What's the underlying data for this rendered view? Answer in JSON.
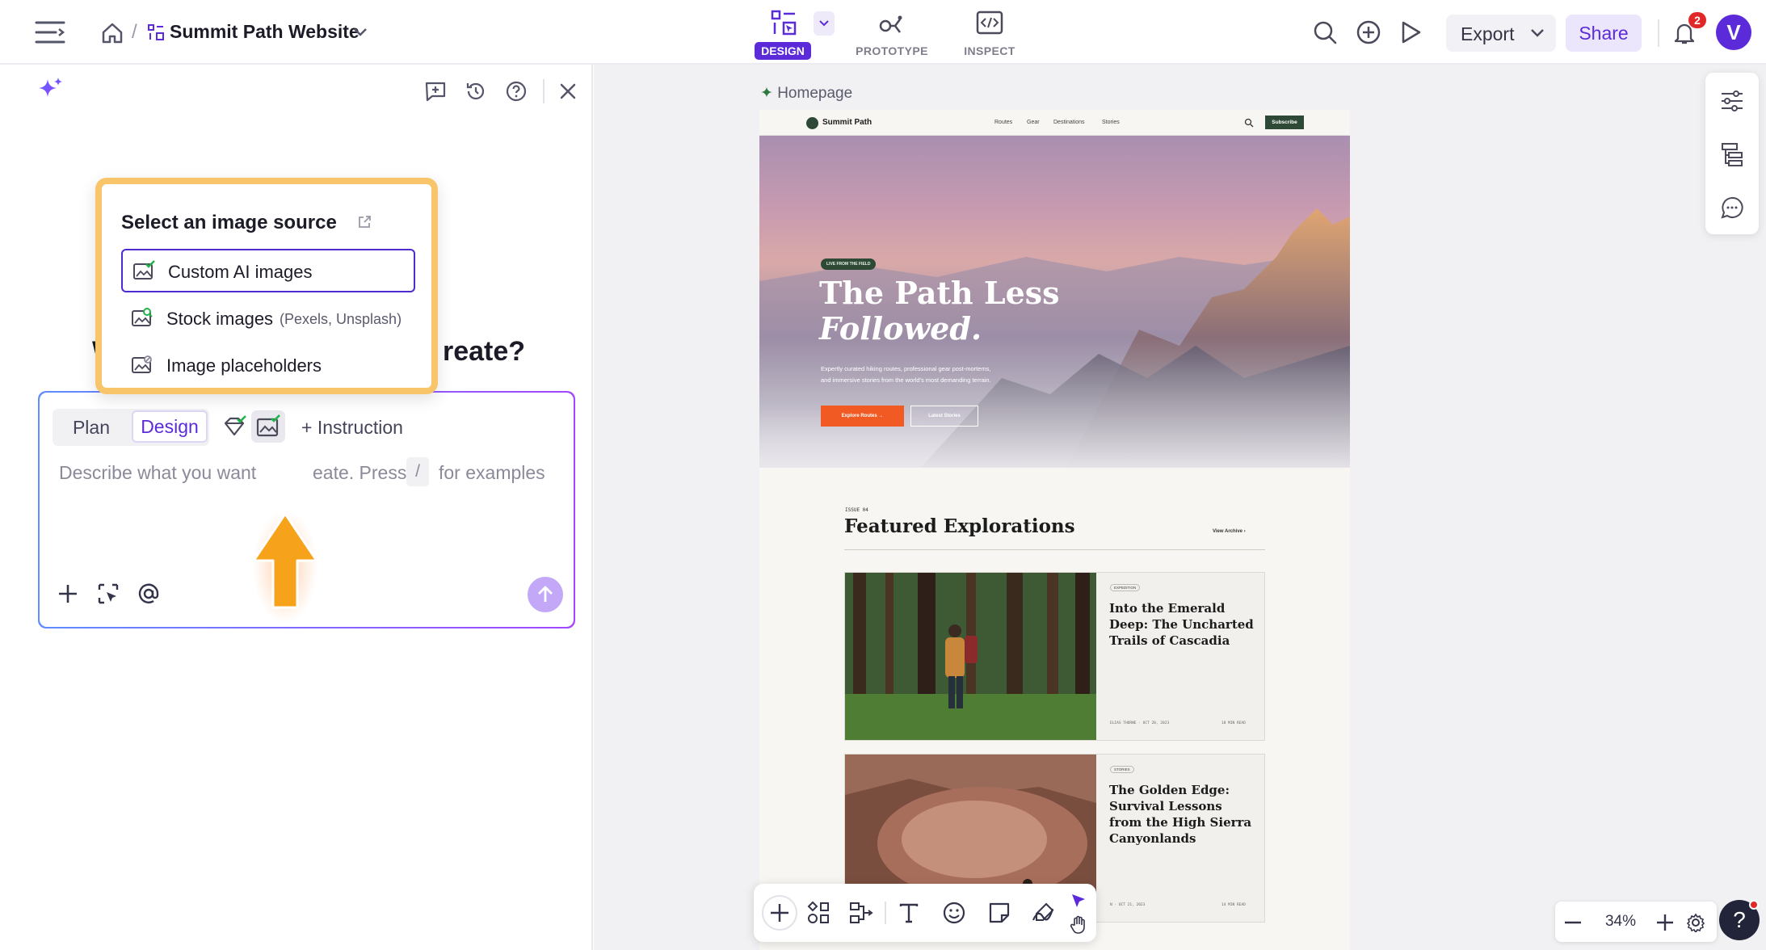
{
  "topbar": {
    "breadcrumb_separator": "/",
    "project_name": "Summit Path Website",
    "modes": [
      {
        "label": "DESIGN",
        "active": true
      },
      {
        "label": "PROTOTYPE",
        "active": false
      },
      {
        "label": "INSPECT",
        "active": false
      }
    ],
    "export_label": "Export",
    "share_label": "Share",
    "notification_count": "2",
    "avatar_initial": "V"
  },
  "panel": {
    "heading_left": "W",
    "heading_right": "reate?",
    "popup": {
      "title": "Select an image source",
      "options": [
        {
          "label": "Custom AI images",
          "note": "",
          "selected": true
        },
        {
          "label": "Stock images",
          "note": "(Pexels, Unsplash)",
          "selected": false
        },
        {
          "label": "Image placeholders",
          "note": "",
          "selected": false
        }
      ]
    },
    "composer": {
      "tab_plan": "Plan",
      "tab_design": "Design",
      "instruction_label": "+ Instruction",
      "placeholder_part1": "Describe what you want",
      "placeholder_part2": "eate. Press",
      "slash_key": "/",
      "placeholder_part3": "for examples"
    }
  },
  "canvas": {
    "frame_label": "Homepage",
    "zoom": "34%",
    "site": {
      "logo": "Summit Path",
      "nav": [
        "Routes",
        "Gear",
        "Destinations",
        "Stories"
      ],
      "subscribe": "Subscribe",
      "hero_badge": "LIVE FROM THE FIELD",
      "hero_title_1": "The Path Less",
      "hero_title_2": "Followed.",
      "hero_text_1": "Expertly curated hiking routes, professional gear post-mortems,",
      "hero_text_2": "and immersive stories from the world's most demanding terrain.",
      "btn_primary": "Explore Routes",
      "btn_secondary": "Latest Stories",
      "issue": "ISSUE 04",
      "section_title": "Featured Explorations",
      "view_archive": "View Archive",
      "cards": [
        {
          "tag": "EXPEDITION",
          "title_1": "Into the Emerald",
          "title_2": "Deep: The Uncharted",
          "title_3": "Trails of Cascadia",
          "title_4": "",
          "meta_left": "ELIAS THORNE · OCT 28, 2023",
          "meta_right": "18 MIN READ"
        },
        {
          "tag": "STORIES",
          "title_1": "The Golden Edge:",
          "title_2": "Survival Lessons",
          "title_3": "from the High Sierra",
          "title_4": "Canyonlands",
          "meta_left": "N · OCT 21, 2023",
          "meta_right": "14 MIN READ"
        }
      ]
    }
  },
  "colors": {
    "accent_purple": "#5b2bd9",
    "popup_highlight": "#f8c56a",
    "arrow_orange": "#f7a21b",
    "site_green": "#2e4a36",
    "site_orange": "#f15a22",
    "notification_red": "#e02828"
  }
}
